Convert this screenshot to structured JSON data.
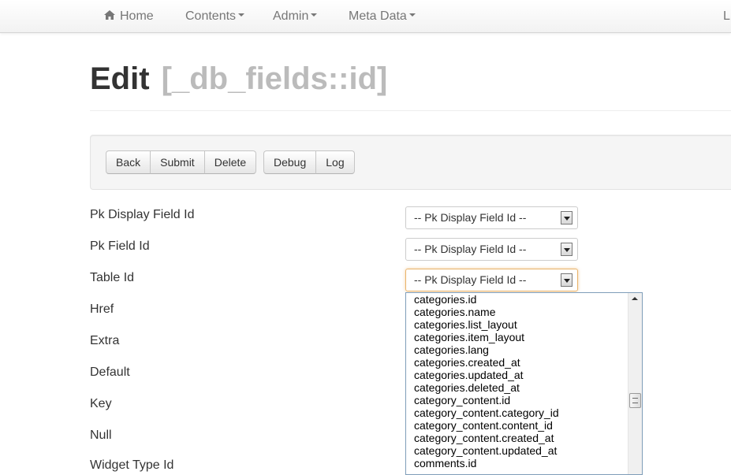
{
  "nav": {
    "home": "Home",
    "contents": "Contents",
    "admin": "Admin",
    "meta_data": "Meta Data",
    "right_partial": "L"
  },
  "header": {
    "title": "Edit",
    "subtitle": "[_db_fields::id]"
  },
  "toolbar": {
    "back": "Back",
    "submit": "Submit",
    "delete": "Delete",
    "debug": "Debug",
    "log": "Log"
  },
  "form": {
    "labels": {
      "pk_display_field_id": "Pk Display Field Id",
      "pk_field_id": "Pk Field Id",
      "table_id": "Table Id",
      "href": "Href",
      "extra": "Extra",
      "default": "Default",
      "key": "Key",
      "null": "Null",
      "widget_type_id": "Widget Type Id"
    },
    "selects": {
      "pk_display_field_id": "-- Pk Display Field Id --",
      "pk_field_id": "-- Pk Display Field Id --",
      "table_id": "-- Pk Display Field Id --"
    }
  },
  "dropdown": {
    "options": [
      "categories.id",
      "categories.name",
      "categories.list_layout",
      "categories.item_layout",
      "categories.lang",
      "categories.created_at",
      "categories.updated_at",
      "categories.deleted_at",
      "category_content.id",
      "category_content.category_id",
      "category_content.content_id",
      "category_content.created_at",
      "category_content.updated_at",
      "comments.id"
    ]
  }
}
